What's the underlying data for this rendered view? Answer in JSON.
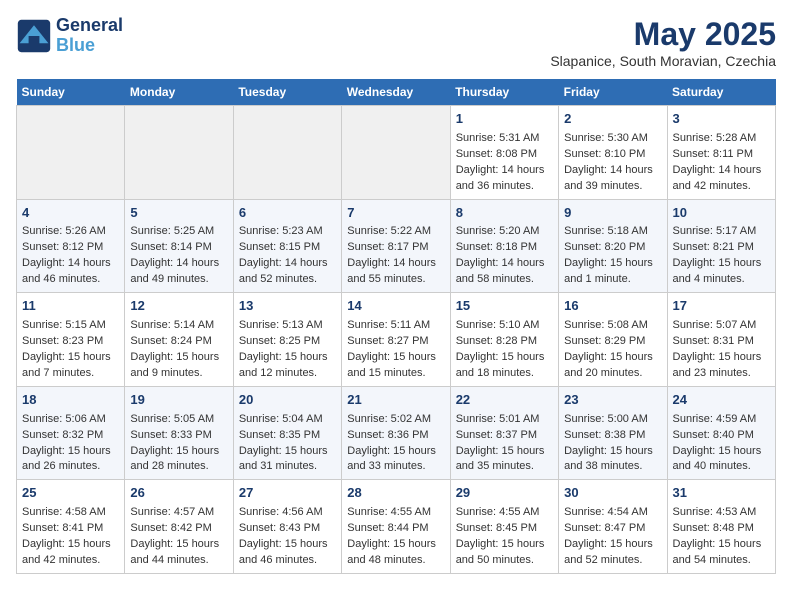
{
  "header": {
    "logo_line1": "General",
    "logo_line2": "Blue",
    "month": "May 2025",
    "location": "Slapanice, South Moravian, Czechia"
  },
  "weekdays": [
    "Sunday",
    "Monday",
    "Tuesday",
    "Wednesday",
    "Thursday",
    "Friday",
    "Saturday"
  ],
  "weeks": [
    [
      {
        "day": "",
        "info": ""
      },
      {
        "day": "",
        "info": ""
      },
      {
        "day": "",
        "info": ""
      },
      {
        "day": "",
        "info": ""
      },
      {
        "day": "1",
        "info": "Sunrise: 5:31 AM\nSunset: 8:08 PM\nDaylight: 14 hours\nand 36 minutes."
      },
      {
        "day": "2",
        "info": "Sunrise: 5:30 AM\nSunset: 8:10 PM\nDaylight: 14 hours\nand 39 minutes."
      },
      {
        "day": "3",
        "info": "Sunrise: 5:28 AM\nSunset: 8:11 PM\nDaylight: 14 hours\nand 42 minutes."
      }
    ],
    [
      {
        "day": "4",
        "info": "Sunrise: 5:26 AM\nSunset: 8:12 PM\nDaylight: 14 hours\nand 46 minutes."
      },
      {
        "day": "5",
        "info": "Sunrise: 5:25 AM\nSunset: 8:14 PM\nDaylight: 14 hours\nand 49 minutes."
      },
      {
        "day": "6",
        "info": "Sunrise: 5:23 AM\nSunset: 8:15 PM\nDaylight: 14 hours\nand 52 minutes."
      },
      {
        "day": "7",
        "info": "Sunrise: 5:22 AM\nSunset: 8:17 PM\nDaylight: 14 hours\nand 55 minutes."
      },
      {
        "day": "8",
        "info": "Sunrise: 5:20 AM\nSunset: 8:18 PM\nDaylight: 14 hours\nand 58 minutes."
      },
      {
        "day": "9",
        "info": "Sunrise: 5:18 AM\nSunset: 8:20 PM\nDaylight: 15 hours\nand 1 minute."
      },
      {
        "day": "10",
        "info": "Sunrise: 5:17 AM\nSunset: 8:21 PM\nDaylight: 15 hours\nand 4 minutes."
      }
    ],
    [
      {
        "day": "11",
        "info": "Sunrise: 5:15 AM\nSunset: 8:23 PM\nDaylight: 15 hours\nand 7 minutes."
      },
      {
        "day": "12",
        "info": "Sunrise: 5:14 AM\nSunset: 8:24 PM\nDaylight: 15 hours\nand 9 minutes."
      },
      {
        "day": "13",
        "info": "Sunrise: 5:13 AM\nSunset: 8:25 PM\nDaylight: 15 hours\nand 12 minutes."
      },
      {
        "day": "14",
        "info": "Sunrise: 5:11 AM\nSunset: 8:27 PM\nDaylight: 15 hours\nand 15 minutes."
      },
      {
        "day": "15",
        "info": "Sunrise: 5:10 AM\nSunset: 8:28 PM\nDaylight: 15 hours\nand 18 minutes."
      },
      {
        "day": "16",
        "info": "Sunrise: 5:08 AM\nSunset: 8:29 PM\nDaylight: 15 hours\nand 20 minutes."
      },
      {
        "day": "17",
        "info": "Sunrise: 5:07 AM\nSunset: 8:31 PM\nDaylight: 15 hours\nand 23 minutes."
      }
    ],
    [
      {
        "day": "18",
        "info": "Sunrise: 5:06 AM\nSunset: 8:32 PM\nDaylight: 15 hours\nand 26 minutes."
      },
      {
        "day": "19",
        "info": "Sunrise: 5:05 AM\nSunset: 8:33 PM\nDaylight: 15 hours\nand 28 minutes."
      },
      {
        "day": "20",
        "info": "Sunrise: 5:04 AM\nSunset: 8:35 PM\nDaylight: 15 hours\nand 31 minutes."
      },
      {
        "day": "21",
        "info": "Sunrise: 5:02 AM\nSunset: 8:36 PM\nDaylight: 15 hours\nand 33 minutes."
      },
      {
        "day": "22",
        "info": "Sunrise: 5:01 AM\nSunset: 8:37 PM\nDaylight: 15 hours\nand 35 minutes."
      },
      {
        "day": "23",
        "info": "Sunrise: 5:00 AM\nSunset: 8:38 PM\nDaylight: 15 hours\nand 38 minutes."
      },
      {
        "day": "24",
        "info": "Sunrise: 4:59 AM\nSunset: 8:40 PM\nDaylight: 15 hours\nand 40 minutes."
      }
    ],
    [
      {
        "day": "25",
        "info": "Sunrise: 4:58 AM\nSunset: 8:41 PM\nDaylight: 15 hours\nand 42 minutes."
      },
      {
        "day": "26",
        "info": "Sunrise: 4:57 AM\nSunset: 8:42 PM\nDaylight: 15 hours\nand 44 minutes."
      },
      {
        "day": "27",
        "info": "Sunrise: 4:56 AM\nSunset: 8:43 PM\nDaylight: 15 hours\nand 46 minutes."
      },
      {
        "day": "28",
        "info": "Sunrise: 4:55 AM\nSunset: 8:44 PM\nDaylight: 15 hours\nand 48 minutes."
      },
      {
        "day": "29",
        "info": "Sunrise: 4:55 AM\nSunset: 8:45 PM\nDaylight: 15 hours\nand 50 minutes."
      },
      {
        "day": "30",
        "info": "Sunrise: 4:54 AM\nSunset: 8:47 PM\nDaylight: 15 hours\nand 52 minutes."
      },
      {
        "day": "31",
        "info": "Sunrise: 4:53 AM\nSunset: 8:48 PM\nDaylight: 15 hours\nand 54 minutes."
      }
    ]
  ]
}
